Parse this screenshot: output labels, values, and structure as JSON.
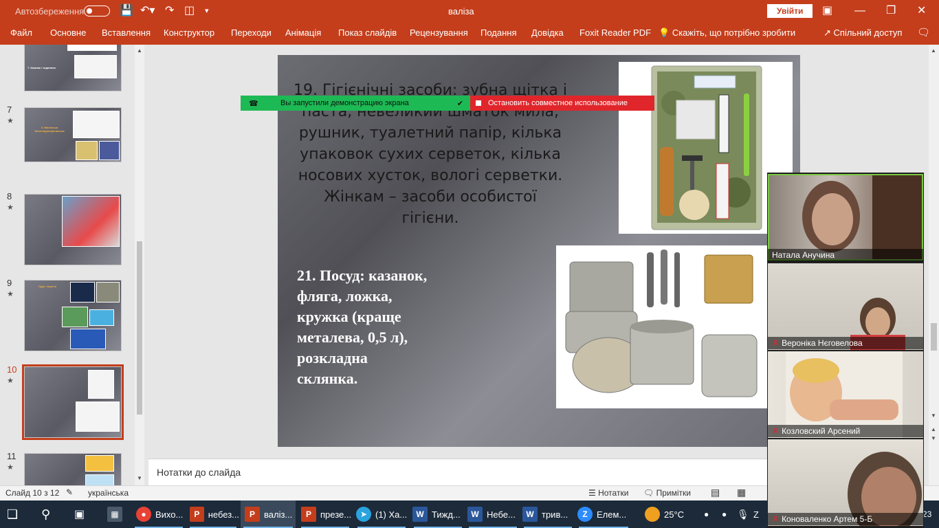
{
  "titlebar": {
    "autosave": "Автозбереження",
    "doc_title": "валіза",
    "login": "Увійти"
  },
  "ribbon": {
    "tabs": [
      "Файл",
      "Основне",
      "Вставлення",
      "Конструктор",
      "Переходи",
      "Анімація",
      "Показ слайдів",
      "Рецензування",
      "Подання",
      "Довідка",
      "Foxit Reader PDF"
    ],
    "tellme": "Скажіть, що потрібно зробити",
    "share": "Спільний доступ"
  },
  "thumbs": {
    "t6": {
      "text": "7. Компас і годинник"
    },
    "t7": {
      "num": "7",
      "title": "5. Маленька багатофункціональна"
    },
    "t8": {
      "num": "8"
    },
    "t9": {
      "num": "9",
      "title": "Одяг і взуття"
    },
    "t10": {
      "num": "10"
    },
    "t11": {
      "num": "11"
    }
  },
  "slide": {
    "text1": [
      "19. Гігієнічні засоби: зубна щітка і",
      "паста, невеликий шматок мила,",
      "рушник,  туалетний папір, кілька",
      "упаковок сухих серветок, кілька",
      "носових хусток, вологі серветки.",
      "Жінкам – засоби особистої",
      "гігієни."
    ],
    "text2": [
      "21. Посуд: казанок,",
      "фляга, ложка,",
      "кружка (краще",
      "металева, 0,5 л),",
      "розкладна",
      "склянка."
    ]
  },
  "banners": {
    "green": "Вы запустили демонстрацию экрана",
    "red": "Остановить совместное использование"
  },
  "notes": "Нотатки до слайда",
  "status": {
    "slide": "Слайд 10 з 12",
    "lang": "українська",
    "notes": "Нотатки",
    "comments": "Примітки"
  },
  "video": {
    "p1": "Натала Анучина",
    "p2": "Вероніка Нєговелова",
    "p3": "Козловский Арсений",
    "p4": "Коноваленко Артем 5-Б"
  },
  "taskbar": {
    "apps": [
      {
        "label": "Вихо...",
        "color": "#e94235"
      },
      {
        "label": "небез...",
        "color": "#c43e1c"
      },
      {
        "label": "валіз...",
        "color": "#c43e1c"
      },
      {
        "label": "презе...",
        "color": "#c43e1c"
      },
      {
        "label": "(1) Ха...",
        "color": "#2aa3de"
      },
      {
        "label": "Тижд...",
        "color": "#2b579a"
      },
      {
        "label": "Небе...",
        "color": "#2b579a"
      },
      {
        "label": "трив...",
        "color": "#2b579a"
      },
      {
        "label": "Елем...",
        "color": "#2d8cff"
      }
    ],
    "weather": "25°C",
    "clock": "23"
  }
}
